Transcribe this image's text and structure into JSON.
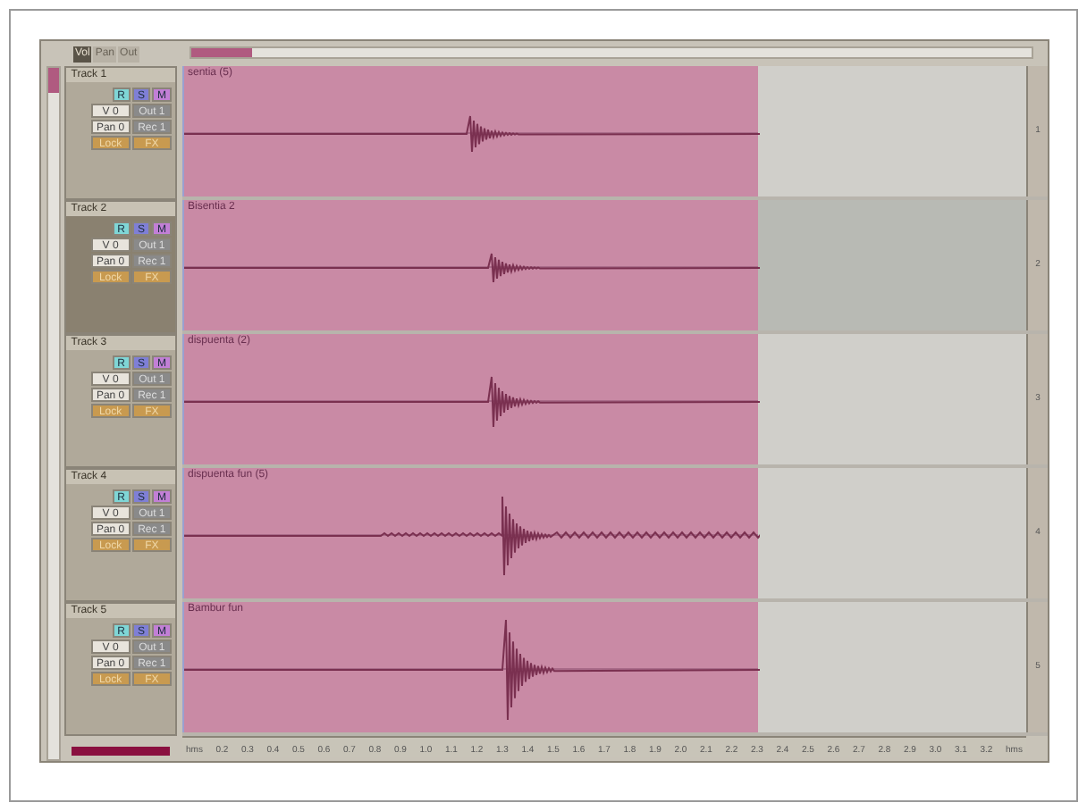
{
  "toolbar_tabs": [
    {
      "label": "Vol",
      "selected": true
    },
    {
      "label": "Pan",
      "selected": false
    },
    {
      "label": "Out",
      "selected": false
    }
  ],
  "tracks": [
    {
      "name": "Track 1",
      "selected": false,
      "clip": "sentia (5)",
      "number": "1",
      "buttons": [
        "R",
        "S",
        "M"
      ],
      "volume": "V 0",
      "output": "Out 1",
      "pan": "Pan 0",
      "record": "Rec 1",
      "lock": "Lock",
      "fx": "FX"
    },
    {
      "name": "Track 2",
      "selected": true,
      "clip": "Bisentia 2",
      "number": "2",
      "buttons": [
        "R",
        "S",
        "M"
      ],
      "volume": "V 0",
      "output": "Out 1",
      "pan": "Pan 0",
      "record": "Rec 1",
      "lock": "Lock",
      "fx": "FX"
    },
    {
      "name": "Track 3",
      "selected": false,
      "clip": "dispuenta (2)",
      "number": "3",
      "buttons": [
        "R",
        "S",
        "M"
      ],
      "volume": "V 0",
      "output": "Out 1",
      "pan": "Pan 0",
      "record": "Rec 1",
      "lock": "Lock",
      "fx": "FX"
    },
    {
      "name": "Track 4",
      "selected": false,
      "clip": "dispuenta fun (5)",
      "number": "4",
      "buttons": [
        "R",
        "S",
        "M"
      ],
      "volume": "V 0",
      "output": "Out 1",
      "pan": "Pan 0",
      "record": "Rec 1",
      "lock": "Lock",
      "fx": "FX"
    },
    {
      "name": "Track 5",
      "selected": false,
      "clip": "Bambur fun",
      "number": "5",
      "buttons": [
        "R",
        "S",
        "M"
      ],
      "volume": "V 0",
      "output": "Out 1",
      "pan": "Pan 0",
      "record": "Rec 1",
      "lock": "Lock",
      "fx": "FX"
    }
  ],
  "ruler": [
    "hms",
    "0.2",
    "0.3",
    "0.4",
    "0.5",
    "0.6",
    "0.7",
    "0.8",
    "0.9",
    "1.0",
    "1.1",
    "1.2",
    "1.3",
    "1.4",
    "1.5",
    "1.6",
    "1.7",
    "1.8",
    "1.9",
    "2.0",
    "2.1",
    "2.2",
    "2.3",
    "2.4",
    "2.5",
    "2.6",
    "2.7",
    "2.8",
    "2.9",
    "3.0",
    "3.1",
    "3.2",
    "hms"
  ]
}
